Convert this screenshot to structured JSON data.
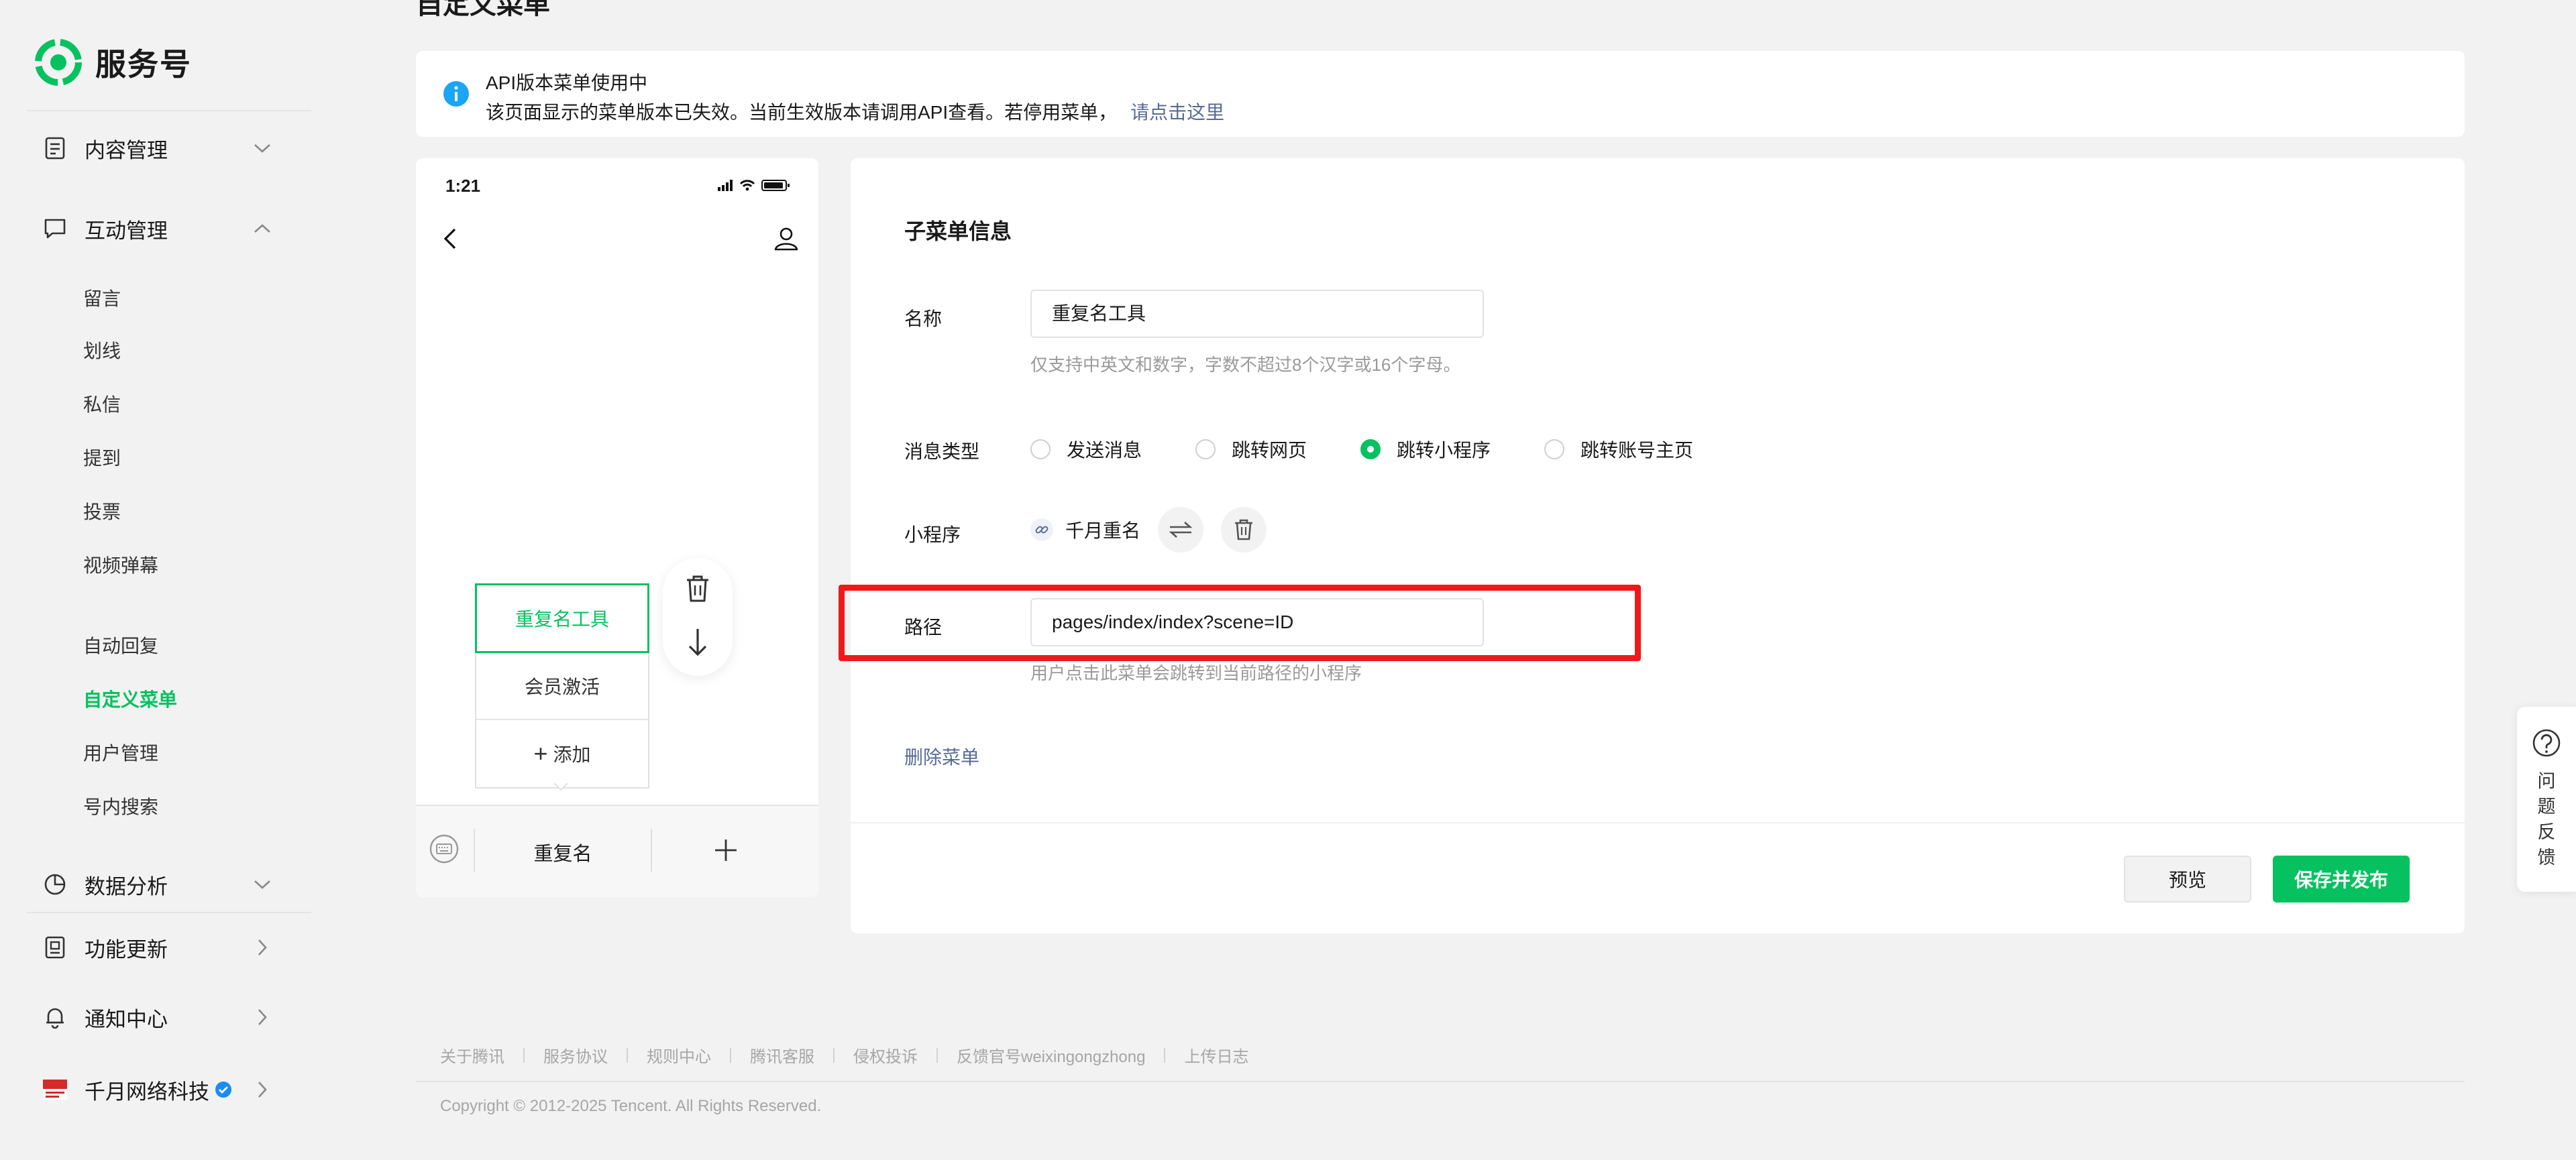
{
  "brand": {
    "name": "服务号"
  },
  "top_partial_title": "自定义菜单",
  "sidebar": {
    "content_mgmt": "内容管理",
    "interaction_mgmt": "互动管理",
    "interaction_items": [
      "留言",
      "划线",
      "私信",
      "提到",
      "投票",
      "视频弹幕"
    ],
    "more_items": [
      "自动回复",
      "自定义菜单",
      "用户管理",
      "号内搜索"
    ],
    "active_item": "自定义菜单",
    "data_analysis": "数据分析",
    "feature_updates": "功能更新",
    "notification_center": "通知中心",
    "account_name": "千月网络科技"
  },
  "notice": {
    "title": "API版本菜单使用中",
    "text": "该页面显示的菜单版本已失效。当前生效版本请调用API查看。若停用菜单，",
    "link": "请点击这里"
  },
  "phone": {
    "time": "1:21",
    "submenus": [
      "重复名工具",
      "会员激活"
    ],
    "add_label": "添加",
    "bottom_menu": "重复名"
  },
  "form": {
    "title": "子菜单信息",
    "name_label": "名称",
    "name_value": "重复名工具",
    "name_hint": "仅支持中英文和数字，字数不超过8个汉字或16个字母。",
    "msg_type_label": "消息类型",
    "msg_types": [
      "发送消息",
      "跳转网页",
      "跳转小程序",
      "跳转账号主页"
    ],
    "msg_type_selected": "跳转小程序",
    "miniprogram_label": "小程序",
    "miniprogram_name": "千月重名",
    "path_label": "路径",
    "path_value": "pages/index/index?scene=ID",
    "path_hint": "用户点击此菜单会跳转到当前路径的小程序",
    "delete_label": "删除菜单",
    "preview_label": "预览",
    "publish_label": "保存并发布"
  },
  "feedback": {
    "label": "问题反馈"
  },
  "footer": {
    "links": [
      "关于腾讯",
      "服务协议",
      "规则中心",
      "腾讯客服",
      "侵权投诉",
      "反馈官号weixingongzhong",
      "上传日志"
    ],
    "copyright": "Copyright © 2012-2025 Tencent. All Rights Reserved."
  },
  "colors": {
    "accent": "#07c160",
    "link": "#576b95",
    "highlight": "#ee1a1a",
    "info": "#1aa5f5"
  }
}
